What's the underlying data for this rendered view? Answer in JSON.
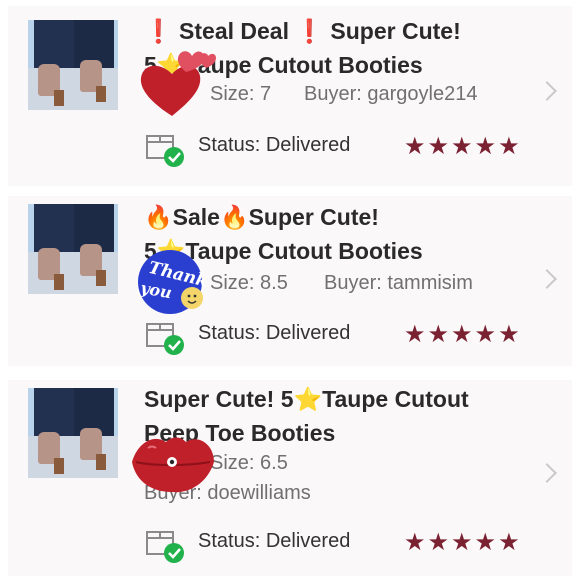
{
  "orders": [
    {
      "title_line1": "❗ Steal Deal ❗ Super Cute!",
      "title_line2": "5⭐Taupe Cutout Booties",
      "size": "Size: 7",
      "buyer": "Buyer: gargoyle214",
      "status_label": "Status:",
      "status_value": "Delivered",
      "rating": 5,
      "sticker": "hearts"
    },
    {
      "title_line1": "🔥Sale🔥Super Cute!",
      "title_line2": "5⭐Taupe Cutout Booties",
      "size": "Size: 8.5",
      "buyer": "Buyer: tammisim",
      "status_label": "Status:",
      "status_value": "Delivered",
      "rating": 5,
      "sticker": "thank-you",
      "sticker_text": [
        "Thank",
        "you"
      ]
    },
    {
      "title_line1": "Super Cute! 5⭐Taupe Cutout",
      "title_line2": "Peep Toe Booties",
      "size": "Size: 6.5",
      "buyer": "Buyer: doewilliams",
      "status_label": "Status:",
      "status_value": "Delivered",
      "rating": 5,
      "sticker": "lips"
    }
  ],
  "colors": {
    "star": "#7a2231",
    "check": "#22b24c",
    "card_bg": "#fbf8fa",
    "sticker_red": "#c0202a",
    "sticker_blue": "#2a3fd0"
  },
  "icons": {
    "chevron": "chevron-right-icon",
    "status": "delivered-box-icon",
    "star": "star-icon"
  }
}
